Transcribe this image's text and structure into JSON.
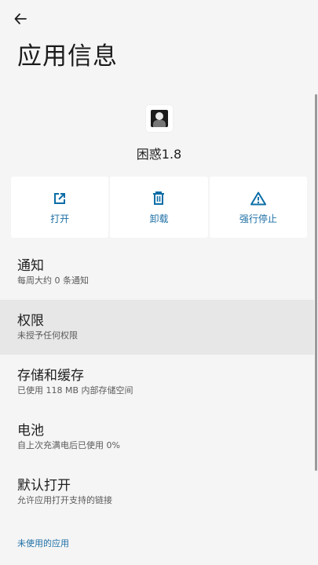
{
  "header": {
    "title": "应用信息",
    "back_icon": "arrow-left-icon"
  },
  "app": {
    "name": "困惑1.8",
    "icon": "app-avatar-icon"
  },
  "actions": [
    {
      "label": "打开",
      "icon": "open-external-icon"
    },
    {
      "label": "卸载",
      "icon": "trash-icon"
    },
    {
      "label": "强行停止",
      "icon": "warning-icon"
    }
  ],
  "settings": [
    {
      "title": "通知",
      "subtitle": "每周大约 0 条通知"
    },
    {
      "title": "权限",
      "subtitle": "未授予任何权限"
    },
    {
      "title": "存储和缓存",
      "subtitle": "已使用 118 MB 内部存储空间"
    },
    {
      "title": "电池",
      "subtitle": "自上次充满电后已使用 0%"
    },
    {
      "title": "默认打开",
      "subtitle": "允许应用打开支持的链接"
    }
  ],
  "section_link": "未使用的应用",
  "colors": {
    "accent": "#1d6fa5",
    "background": "#f5f5f5",
    "selected_row": "#e7e7e7"
  }
}
